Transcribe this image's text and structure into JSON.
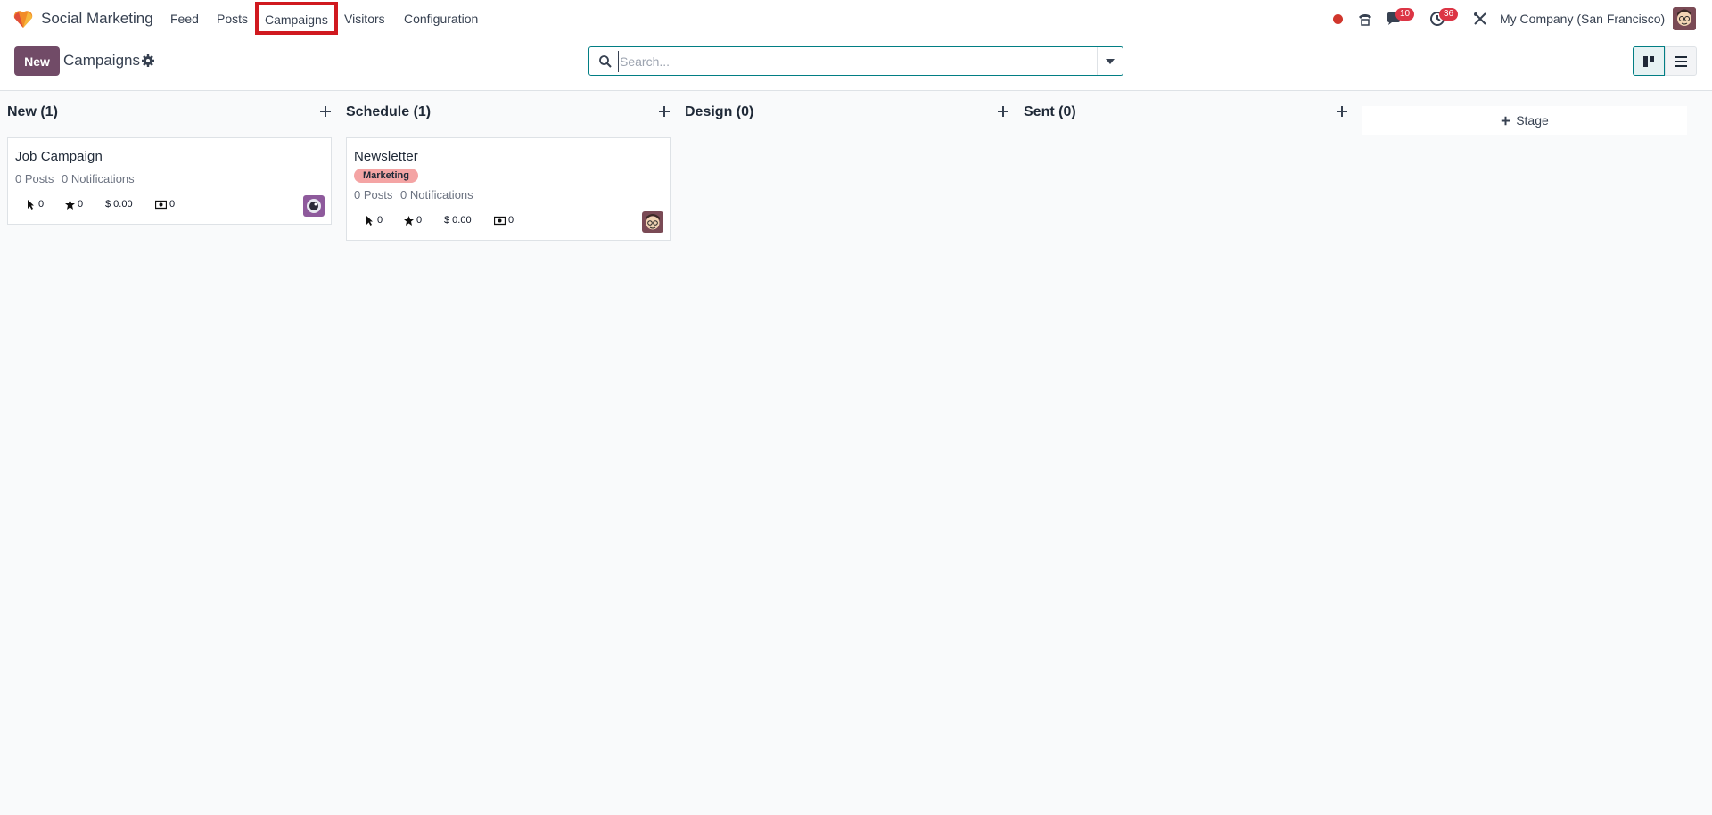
{
  "navbar": {
    "app_name": "Social Marketing",
    "menu": [
      "Feed",
      "Posts",
      "Campaigns",
      "Visitors",
      "Configuration"
    ],
    "active_menu": "Campaigns",
    "messages_count": "10",
    "activities_count": "36",
    "company": "My Company (San Francisco)"
  },
  "control": {
    "new_label": "New",
    "title": "Campaigns",
    "search_placeholder": "Search..."
  },
  "columns": [
    {
      "label": "New (1)"
    },
    {
      "label": "Schedule (1)"
    },
    {
      "label": "Design (0)"
    },
    {
      "label": "Sent (0)"
    }
  ],
  "cards": [
    {
      "title": "Job Campaign",
      "posts": "0 Posts",
      "notifications": "0 Notifications",
      "clicks": "0",
      "stars": "0",
      "revenue": "$ 0.00",
      "cost": "0"
    },
    {
      "title": "Newsletter",
      "tag": "Marketing",
      "posts": "0 Posts",
      "notifications": "0 Notifications",
      "clicks": "0",
      "stars": "0",
      "revenue": "$ 0.00",
      "cost": "0"
    }
  ],
  "add_stage_label": "Stage",
  "colors": {
    "brand": "#714b67",
    "accent": "#017e84",
    "tag": "#f4a4a4",
    "highlight": "#d0191f"
  }
}
